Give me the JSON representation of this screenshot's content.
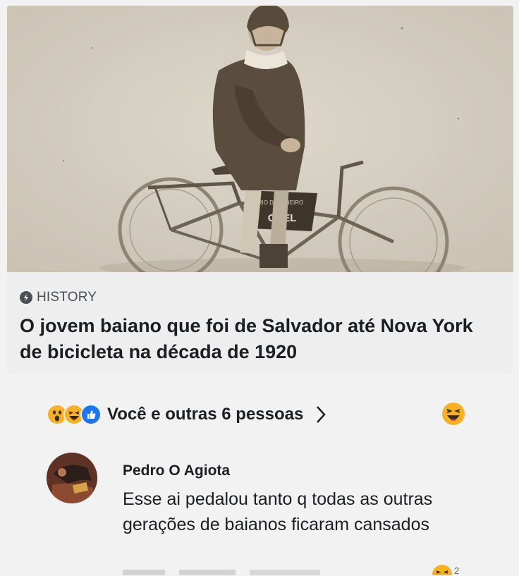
{
  "post": {
    "link_preview": {
      "image": "vintage-photo-young-man-with-bicycle",
      "source_icon": "lightning-bolt-icon",
      "source": "HISTORY",
      "headline": "O jovem baiano que foi de Salvador até Nova York de bicicleta na década de 1920"
    },
    "reactions": {
      "icons": [
        "wow-reaction-icon",
        "haha-reaction-icon",
        "like-reaction-icon"
      ],
      "summary": "Você e outras 6 pessoas",
      "current_reaction_icon": "haha-reaction-icon"
    },
    "comment": {
      "author": "Pedro O Agiota",
      "text": "Esse ai pedalou tanto q todas as outras gerações de baianos ficaram cansados",
      "reaction_icon": "haha-reaction-icon",
      "reaction_count": "2"
    }
  },
  "colors": {
    "background": "#f2f2f2",
    "text": "#1c1e21",
    "like_blue": "#1877f2",
    "reaction_yellow": "#f7b125"
  }
}
